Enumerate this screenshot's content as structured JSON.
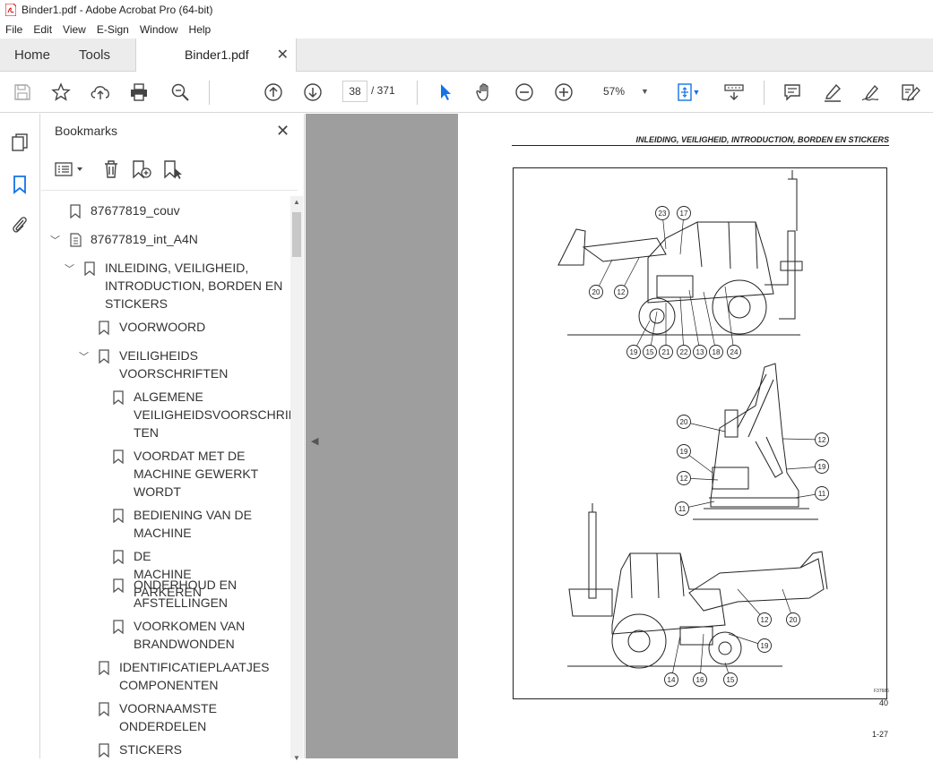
{
  "window": {
    "title": "Binder1.pdf - Adobe Acrobat Pro (64-bit)"
  },
  "menu": [
    "File",
    "Edit",
    "View",
    "E-Sign",
    "Window",
    "Help"
  ],
  "tabs": {
    "home": "Home",
    "tools": "Tools",
    "document": "Binder1.pdf"
  },
  "toolbar": {
    "current_page": "38",
    "page_total": "/ 371",
    "zoom": "57%"
  },
  "bookmarks": {
    "title": "Bookmarks",
    "items": [
      {
        "label": "87677819_couv"
      },
      {
        "label": "87677819_int_A4N"
      },
      {
        "label": "INLEIDING, VEILIGHEID,\nINTRODUCTION, BORDEN EN\nSTICKERS"
      },
      {
        "label": "VOORWOORD"
      },
      {
        "label": "VEILIGHEIDS\nVOORSCHRIFTEN"
      },
      {
        "label": "ALGEMENE\nVEILIGHEIDSVOORSCHRIF\nTEN"
      },
      {
        "label": "VOORDAT MET DE\nMACHINE GEWERKT\nWORDT"
      },
      {
        "label": "BEDIENING VAN DE\nMACHINE"
      },
      {
        "label": "DE MACHINE PARKEREN"
      },
      {
        "label": "ONDERHOUD EN\nAFSTELLINGEN"
      },
      {
        "label": "VOORKOMEN VAN\nBRANDWONDEN"
      },
      {
        "label": "IDENTIFICATIEPLAATJES\nCOMPONENTEN"
      },
      {
        "label": "VOORNAAMSTE\nONDERDELEN"
      },
      {
        "label": "STICKERS"
      }
    ]
  },
  "document_page": {
    "header": "INLEIDING, VEILIGHEID, INTRODUCTION, BORDEN EN STICKERS",
    "figure_number": "40",
    "figure_id": "F37686",
    "page_number": "1-27",
    "callouts_top": [
      "23",
      "17",
      "20",
      "12",
      "19",
      "15",
      "21",
      "22",
      "13",
      "18",
      "24"
    ],
    "callouts_middle": [
      "20",
      "19",
      "12",
      "11",
      "12",
      "19",
      "11"
    ],
    "callouts_bottom": [
      "12",
      "20",
      "19",
      "14",
      "16",
      "15"
    ]
  },
  "colors": {
    "accent": "#1473e6",
    "viewer_bg": "#9e9e9e",
    "tab_bar": "#ececec"
  }
}
